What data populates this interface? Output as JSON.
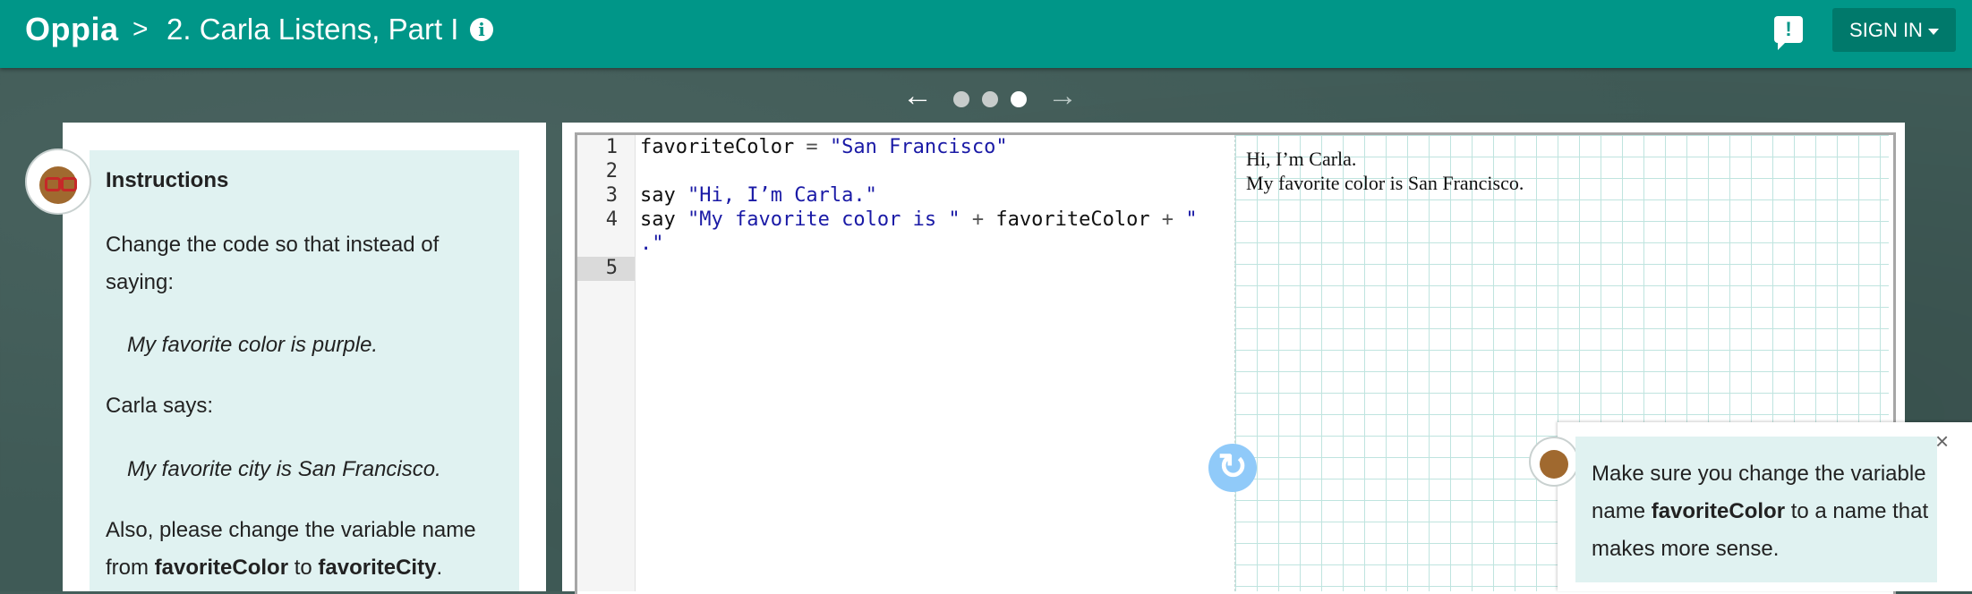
{
  "topbar": {
    "logo": "Oppia",
    "breadcrumb_separator": ">",
    "lesson_title": "2. Carla Listens, Part I",
    "info_glyph": "i",
    "feedback_glyph": "!",
    "signin_label": "SIGN IN"
  },
  "pager": {
    "prev_glyph": "←",
    "next_glyph": "→",
    "dots": 3,
    "active_dot": 3
  },
  "instructions": {
    "heading": "Instructions",
    "p1_line1": "Change the code so that instead of",
    "p1_line2": "saying:",
    "quote1": "My favorite color is purple.",
    "p2": "Carla says:",
    "quote2": "My favorite city is San Francisco.",
    "p3_line1": "Also, please change the variable name",
    "p3_from": "from ",
    "p3_var1": "favoriteColor",
    "p3_to": " to ",
    "p3_var2": "favoriteCity",
    "p3_end": "."
  },
  "editor": {
    "line_numbers": [
      "1",
      "2",
      "3",
      "4",
      "5"
    ],
    "line1_var": "favoriteColor",
    "line1_op": " = ",
    "line1_str": "\"San Francisco\"",
    "line3_kw": "say ",
    "line3_str": "\"Hi, I’m Carla.\"",
    "line4_kw": "say ",
    "line4_str": "\"My favorite color is \"",
    "line4_op1": " + ",
    "line4_var": "favoriteColor",
    "line4_op2": " + ",
    "line4_str2": "\"",
    "line4_wrap": ".\""
  },
  "output": {
    "line1": "Hi, I’m Carla.",
    "line2": "My favorite color is San Francisco.",
    "reload_glyph": "↻"
  },
  "hint": {
    "line1": "Make sure you change the variable",
    "line2_pre": "name ",
    "line2_bold": "favoriteColor",
    "line2_post": " to a name that",
    "line3": "makes more sense.",
    "close_glyph": "×"
  },
  "colors": {
    "topbar": "#009688",
    "signin_bg": "#00796b",
    "instruction_bg": "#e0f2f1",
    "string_color": "#1a1aa6"
  }
}
